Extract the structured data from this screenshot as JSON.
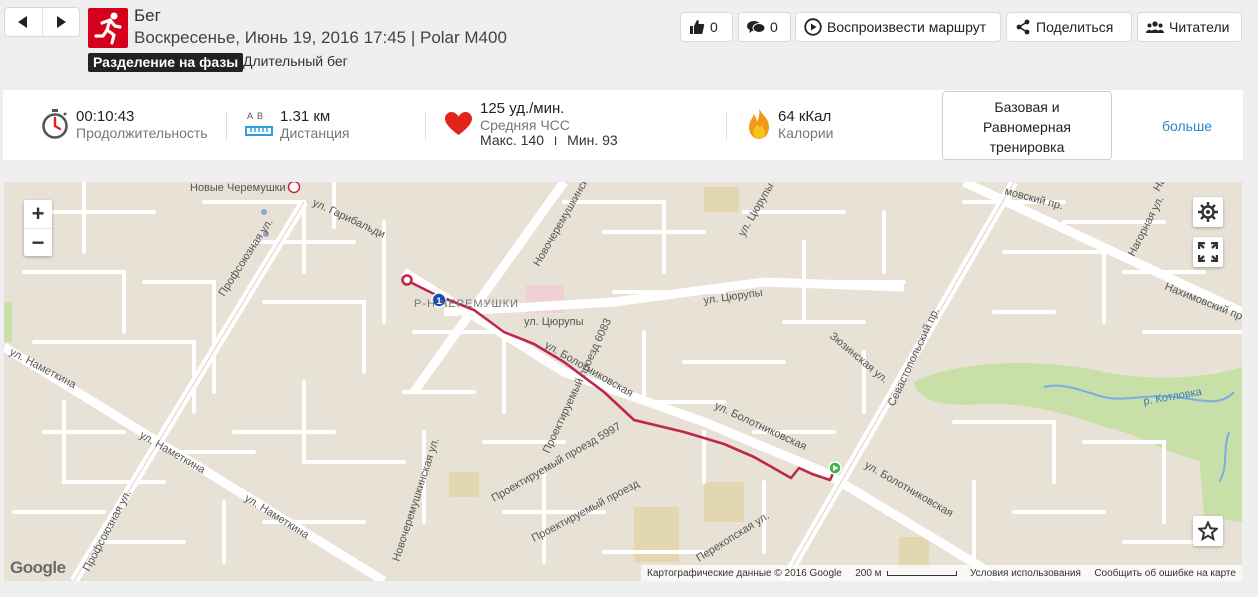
{
  "header": {
    "sport": "Бег",
    "datetime_device": "Воскресенье, Июнь 19, 2016 17:45 | Polar M400",
    "phase_label": "Разделение на фазы",
    "target_label": "Длительный бег"
  },
  "actions": {
    "likes": "0",
    "comments": "0",
    "play_route": "Воспроизвести маршрут",
    "share": "Поделиться",
    "readers": "Читатели"
  },
  "summary": {
    "duration_value": "00:10:43",
    "duration_label": "Продолжительность",
    "distance_ab": "A  B",
    "distance_value": "1.31 км",
    "distance_label": "Дистанция",
    "hr_value": "125 уд./мин.",
    "hr_label": "Средняя ЧСС",
    "hr_max": "Макс. 140",
    "hr_sep": "I",
    "hr_min": "Мин. 93",
    "calories_value": "64 кКал",
    "calories_label": "Калории",
    "benefit_line1": "Базовая и",
    "benefit_line2": "Равномерная",
    "benefit_line3": "тренировка",
    "more": "больше"
  },
  "map": {
    "zoom_in": "+",
    "zoom_out": "−",
    "lap_marker": "1",
    "logo": "Google",
    "attribution": "Картографические данные © 2016 Google",
    "scale": "200 м",
    "terms": "Условия использования",
    "report": "Сообщить об ошибке на карте",
    "labels": {
      "metro": "Новые Черемушки",
      "garibaldi": "ул. Гарибальди",
      "profsoyuz1": "Профсоюзная ул.",
      "profsoyuz2": "Профсоюзная ул.",
      "novocher1": "Новочеремушкинская ул.",
      "novocher2": "Новочеремушкинская ул.",
      "district": "Р-Н ЧЕРЕМУШКИ",
      "tsyurupy1": "ул. Цюрупы",
      "tsyurupy2": "ул. Цюрупы",
      "tsyurupy3": "ул. Цюрупы",
      "bolot1": "ул. Болотниковская",
      "bolot2": "ул. Болотниковская",
      "bolot3": "ул. Болотниковская",
      "nametkina1": "ул. Наметкина",
      "nametkina2": "ул. Наметкина",
      "nametkina3": "ул. Наметкина",
      "pr6083": "Проектируемый проезд 6083",
      "pr5997": "Проектируемый проезд 5997",
      "pr_generic": "Проектируемый проезд",
      "perekop": "Перекопская ул.",
      "zyuzin": "Зюзинская ул.",
      "sevast": "Севастопольский пр.",
      "nakhim": "Нахимовский пр.",
      "nagorn": "Нагорная ул.",
      "kotlovka": "р. Котловка",
      "mosk": "мовский пр.",
      "khim": "Нахимовский пр."
    }
  },
  "colors": {
    "brand_red": "#d5001c",
    "route": "#c0264a",
    "link_blue": "#2a86c7",
    "park_green": "#c8dfa7"
  }
}
